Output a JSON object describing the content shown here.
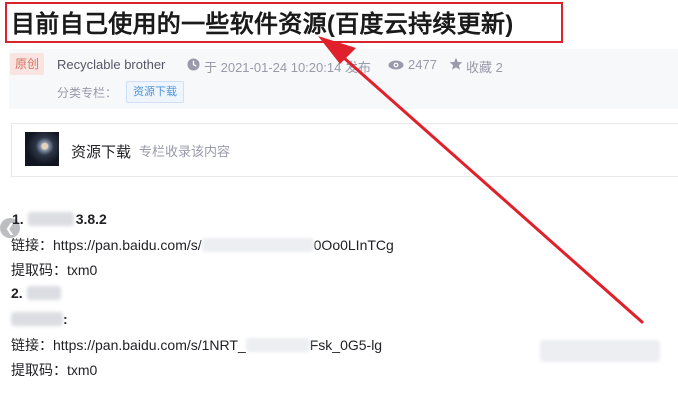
{
  "article": {
    "title": "目前自己使用的一些软件资源(百度云持续更新)",
    "badge": "原创",
    "author": "Recyclable brother",
    "published": "于 2021-01-24 10:20:14 发布",
    "views": "2477",
    "favorites": "收藏 2",
    "column_label": "分类专栏：",
    "column_tag": "资源下载"
  },
  "column_card": {
    "title": "资源下载",
    "subtitle": "专栏收录该内容"
  },
  "content": {
    "item1_num": "1.",
    "item1_tail": "3.8.2",
    "link1_prefix": "链接：https://pan.baidu.com/s/",
    "link1_suffix": "0Oo0LInTCg",
    "pwd1": "提取码：txm0",
    "item2_num": "2.",
    "item2_tail": ":",
    "link2_prefix": "链接：https://pan.baidu.com/s/1NRT_",
    "link2_suffix": "Fsk_0G5-lg",
    "pwd2": "提取码：txm0"
  },
  "icons": {
    "clock": "clock-icon",
    "views": "eye-icon",
    "favorites": "star-icon",
    "slider_prev": "chevron-left-icon"
  },
  "colors": {
    "highlight_red": "#d9242b",
    "tag_blue": "#5094d5",
    "badge_text": "#d3745f"
  }
}
